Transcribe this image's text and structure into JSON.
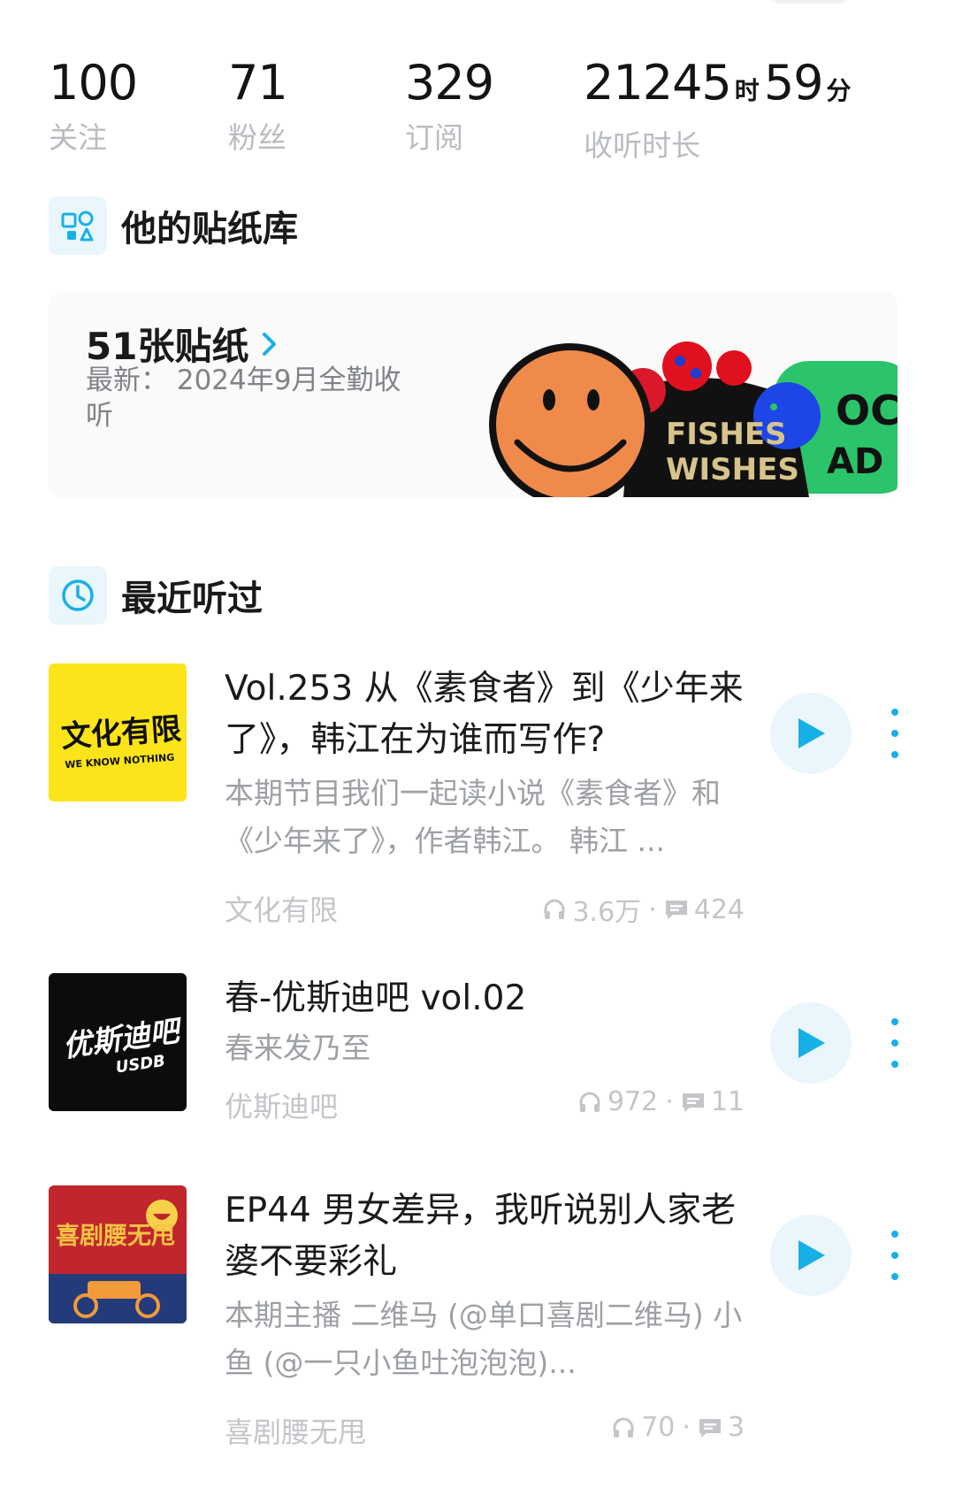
{
  "stats": [
    {
      "value": "100",
      "label": "关注"
    },
    {
      "value": "71",
      "label": "粉丝"
    },
    {
      "value": "329",
      "label": "订阅"
    },
    {
      "hours": "21245",
      "hours_unit": "时",
      "minutes": "59",
      "minutes_unit": "分",
      "label": "收听时长"
    }
  ],
  "sticker_section": {
    "title": "他的贴纸库",
    "icon": "shapes-icon",
    "count_label": "51张贴纸",
    "latest": "最新：  2024年9月全勤收听",
    "sticker_text": [
      "FISHES",
      "WISHES",
      "OC",
      "AD"
    ]
  },
  "recent_section": {
    "title": "最近听过",
    "icon": "clock-icon",
    "items": [
      {
        "cover_text": "文化有限",
        "cover_sub": "WE KNOW NOTHING",
        "title": "Vol.253 从《素食者》到《少年来了》，韩江在为谁而写作?",
        "desc": "本期节目我们一起读小说《素食者》和《少年来了》，作者韩江。 韩江 ...",
        "author": "文化有限",
        "plays": "3.6万",
        "comments": "424"
      },
      {
        "cover_text": "优斯迪吧",
        "cover_sub": "USDB",
        "title": "春-优斯迪吧 vol.02",
        "desc": "春来发乃至",
        "author": "优斯迪吧",
        "plays": "972",
        "comments": "11"
      },
      {
        "cover_text": "喜剧腰无甩",
        "title": "EP44 男女差异，我听说别人家老婆不要彩礼",
        "desc": "本期主播 二维马 (@单口喜剧二维马) 小鱼 (@一只小鱼吐泡泡泡)...",
        "author": "喜剧腰无甩",
        "plays": "70",
        "comments": "3"
      }
    ]
  },
  "colors": {
    "accent": "#17b0e6",
    "icon_bg": "#e9f6fc",
    "muted": "#b9bcc1"
  }
}
